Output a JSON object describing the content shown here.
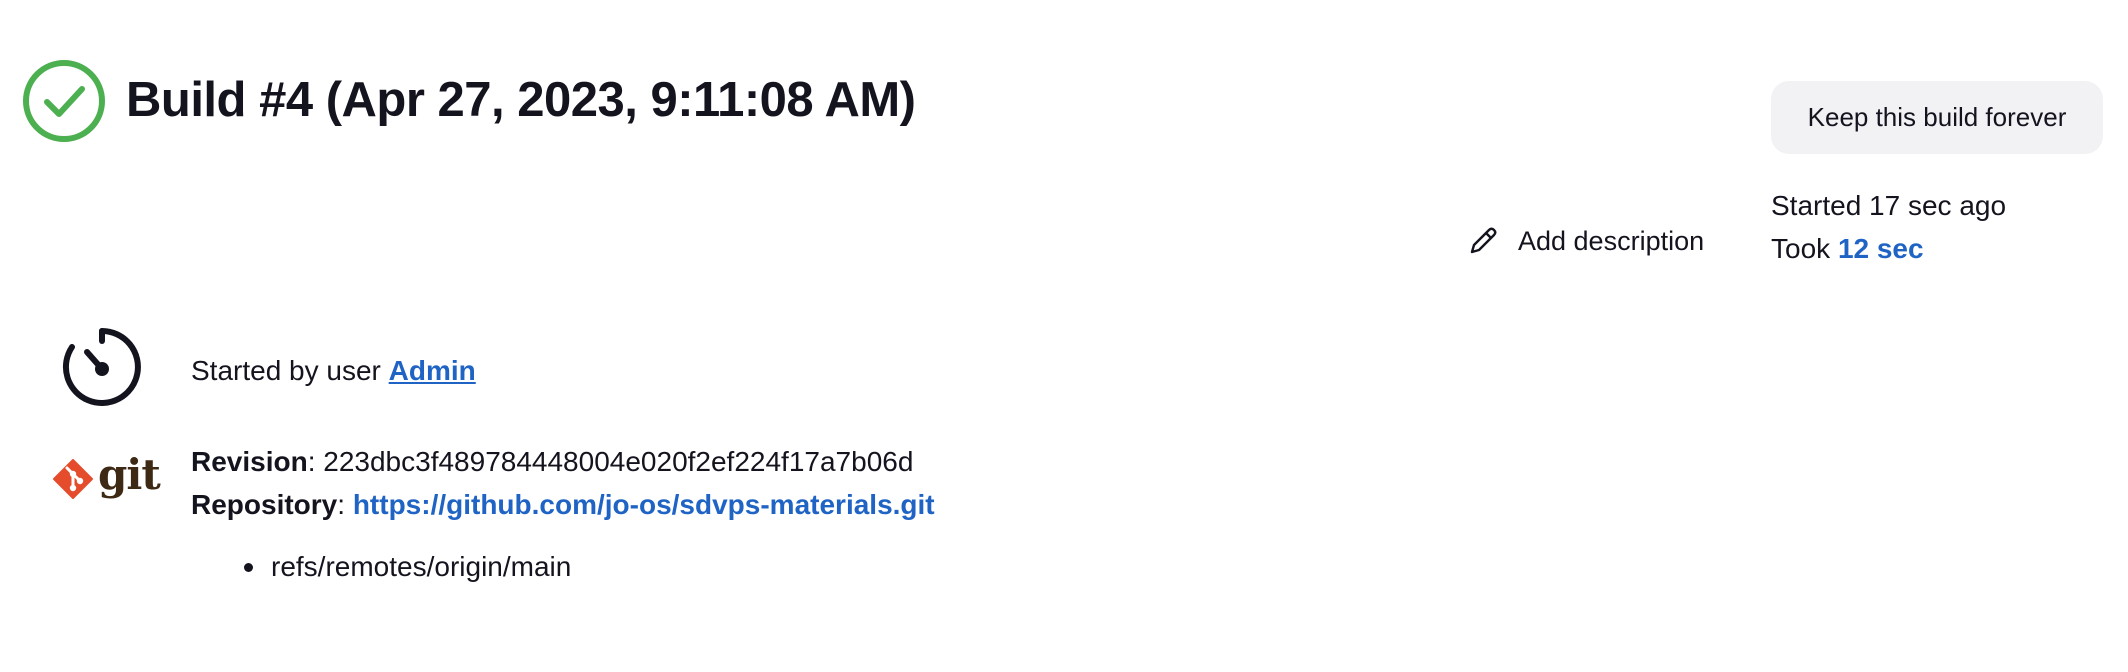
{
  "header": {
    "title": "Build #4 (Apr 27, 2023, 9:11:08 AM)",
    "status_icon": "success-check-icon",
    "status_color": "#4caf50"
  },
  "actions": {
    "keep_forever_label": "Keep this build forever",
    "add_description_label": "Add description",
    "add_description_icon": "pencil-icon"
  },
  "timing": {
    "started_text": "Started 17 sec ago",
    "took_prefix": "Took",
    "took_link": "12 sec"
  },
  "cause": {
    "icon": "timer-icon",
    "prefix": "Started by user",
    "user_link": "Admin"
  },
  "scm": {
    "logo_icon": "git-logo-icon",
    "logo_text": "git",
    "revision_label": "Revision",
    "revision_value": "223dbc3f489784448004e020f2ef224f17a7b06d",
    "repository_label": "Repository",
    "repository_url": "https://github.com/jo-os/sdvps-materials.git",
    "branches": [
      "refs/remotes/origin/main"
    ]
  },
  "colors": {
    "link": "#1f64c4",
    "success": "#4caf50",
    "git_orange": "#e44c2c",
    "button_bg": "#f2f2f5"
  }
}
